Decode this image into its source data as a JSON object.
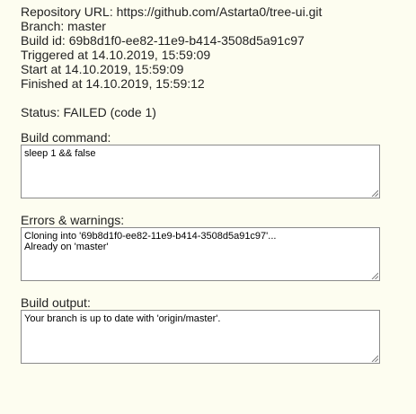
{
  "info": {
    "repository": "Repository URL: https://github.com/Astarta0/tree-ui.git",
    "branch": "Branch: master",
    "build_id": "Build id: 69b8d1f0-ee82-11e9-b414-3508d5a91c97",
    "triggered": "Triggered at 14.10.2019, 15:59:09",
    "start": "Start at 14.10.2019, 15:59:09",
    "finished": "Finished at 14.10.2019, 15:59:12"
  },
  "status": "Status: FAILED (code 1)",
  "fields": {
    "build_command": {
      "label": "Build command:",
      "value": "sleep 1 && false"
    },
    "errors": {
      "label": "Errors & warnings:",
      "value": "Cloning into '69b8d1f0-ee82-11e9-b414-3508d5a91c97'...\nAlready on 'master'"
    },
    "output": {
      "label": "Build output:",
      "value": "Your branch is up to date with 'origin/master'."
    }
  },
  "colors": {
    "background": "#fdfdf0",
    "text": "#222222",
    "border": "#8a8a8a"
  }
}
